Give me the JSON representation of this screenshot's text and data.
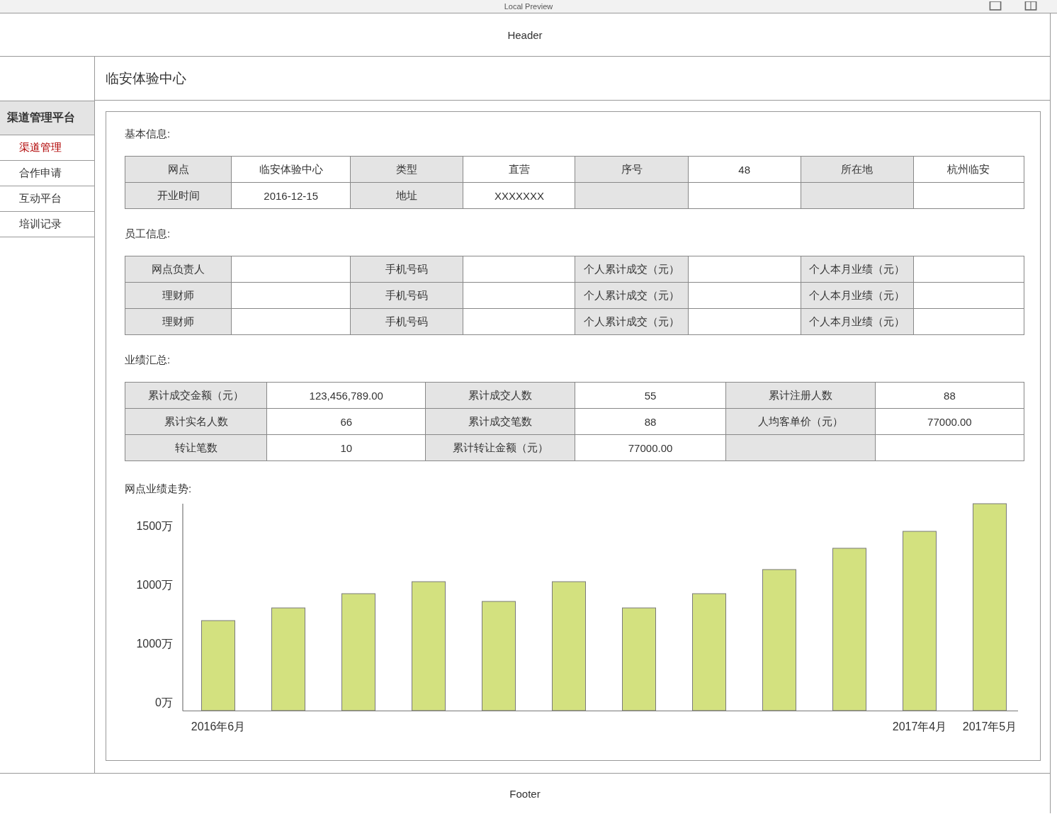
{
  "window": {
    "title": "Local Preview"
  },
  "header": {
    "text": "Header"
  },
  "sidebar": {
    "title": "渠道管理平台",
    "items": [
      {
        "label": "渠道管理",
        "selected": true
      },
      {
        "label": "合作申请",
        "selected": false
      },
      {
        "label": "互动平台",
        "selected": false
      },
      {
        "label": "培训记录",
        "selected": false
      }
    ]
  },
  "page_title": "临安体验中心",
  "sections": [
    {
      "title": "基本信息:",
      "rows": [
        [
          {
            "kind": "label",
            "text": "网点"
          },
          {
            "kind": "value",
            "text": "临安体验中心"
          },
          {
            "kind": "label",
            "text": "类型"
          },
          {
            "kind": "value",
            "text": "直营"
          },
          {
            "kind": "label",
            "text": "序号"
          },
          {
            "kind": "value",
            "text": "48"
          },
          {
            "kind": "label",
            "text": "所在地"
          },
          {
            "kind": "value",
            "text": "杭州临安"
          }
        ],
        [
          {
            "kind": "label",
            "text": "开业时间"
          },
          {
            "kind": "value",
            "text": "2016-12-15"
          },
          {
            "kind": "label",
            "text": "地址"
          },
          {
            "kind": "value",
            "text": "XXXXXXX"
          },
          {
            "kind": "label"
          },
          {
            "kind": "value"
          },
          {
            "kind": "label"
          },
          {
            "kind": "value"
          }
        ]
      ]
    },
    {
      "title": "员工信息:",
      "rows": [
        [
          {
            "kind": "label",
            "text": "网点负责人"
          },
          {
            "kind": "value"
          },
          {
            "kind": "label",
            "text": "手机号码"
          },
          {
            "kind": "value"
          },
          {
            "kind": "label",
            "text": "个人累计成交（元）"
          },
          {
            "kind": "value"
          },
          {
            "kind": "label",
            "text": "个人本月业绩（元）"
          },
          {
            "kind": "value"
          }
        ],
        [
          {
            "kind": "label",
            "text": "理财师"
          },
          {
            "kind": "value"
          },
          {
            "kind": "label",
            "text": "手机号码"
          },
          {
            "kind": "value"
          },
          {
            "kind": "label",
            "text": "个人累计成交（元）"
          },
          {
            "kind": "value"
          },
          {
            "kind": "label",
            "text": "个人本月业绩（元）"
          },
          {
            "kind": "value"
          }
        ],
        [
          {
            "kind": "label",
            "text": "理财师"
          },
          {
            "kind": "value"
          },
          {
            "kind": "label",
            "text": "手机号码"
          },
          {
            "kind": "value"
          },
          {
            "kind": "label",
            "text": "个人累计成交（元）"
          },
          {
            "kind": "value"
          },
          {
            "kind": "label",
            "text": "个人本月业绩（元）"
          },
          {
            "kind": "value"
          }
        ]
      ]
    },
    {
      "title": "业绩汇总:",
      "rows": [
        [
          {
            "kind": "label",
            "text": "累计成交金额（元）"
          },
          {
            "kind": "value",
            "text": "123,456,789.00"
          },
          {
            "kind": "label",
            "text": "累计成交人数"
          },
          {
            "kind": "value",
            "text": "55"
          },
          {
            "kind": "label",
            "text": "累计注册人数"
          },
          {
            "kind": "value",
            "text": "88"
          }
        ],
        [
          {
            "kind": "label",
            "text": "累计实名人数"
          },
          {
            "kind": "value",
            "text": "66"
          },
          {
            "kind": "label",
            "text": "累计成交笔数"
          },
          {
            "kind": "value",
            "text": "88"
          },
          {
            "kind": "label",
            "text": "人均客单价（元）"
          },
          {
            "kind": "value",
            "text": "77000.00"
          }
        ],
        [
          {
            "kind": "label",
            "text": "转让笔数"
          },
          {
            "kind": "value",
            "text": "10"
          },
          {
            "kind": "label",
            "text": "累计转让金额（元）"
          },
          {
            "kind": "value",
            "text": "77000.00"
          },
          {
            "kind": "label"
          },
          {
            "kind": "value"
          }
        ]
      ]
    }
  ],
  "trend": {
    "title": "网点业绩走势:",
    "y_labels": [
      "1500万",
      "1000万",
      "1000万",
      "0万"
    ],
    "x_labels": [
      "2016年6月",
      "2017年4月",
      "2017年5月"
    ]
  },
  "footer": {
    "text": "Footer"
  }
}
